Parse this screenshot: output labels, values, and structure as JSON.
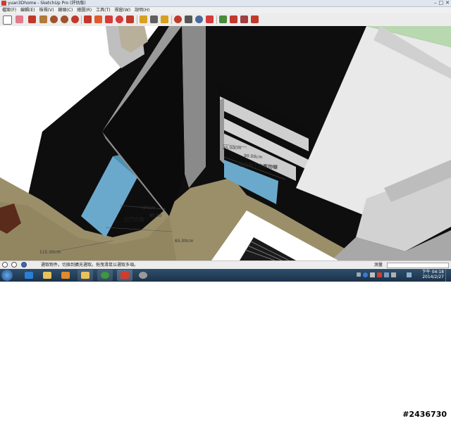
{
  "window": {
    "title": "yuan3Dhome - SketchUp Pro (評估版)",
    "controls": [
      "–",
      "□",
      "✕"
    ]
  },
  "menu": [
    "檔案(F)",
    "編輯(E)",
    "檢視(V)",
    "鏡頭(C)",
    "繪圖(R)",
    "工具(T)",
    "視窗(W)",
    "說明(H)"
  ],
  "toolbar": {
    "tools": [
      {
        "icon": "select-arrow-icon",
        "color": "#3a3a3a"
      },
      {
        "icon": "eraser-icon",
        "color": "#e07a8c"
      },
      {
        "icon": "pencil-line-icon",
        "color": "#c0392b"
      },
      {
        "icon": "rectangle-icon",
        "color": "#b07a3a"
      },
      {
        "icon": "circle-icon",
        "color": "#a0522d"
      },
      {
        "icon": "polygon-icon",
        "color": "#a0522d"
      },
      {
        "icon": "arc-icon",
        "color": "#c0392b"
      },
      {
        "icon": "push-pull-icon",
        "color": "#c0392b"
      },
      {
        "icon": "follow-me-icon",
        "color": "#e05a2a"
      },
      {
        "icon": "move-icon",
        "color": "#d63a3a"
      },
      {
        "icon": "rotate-icon",
        "color": "#d63a3a"
      },
      {
        "icon": "offset-icon",
        "color": "#c0392b"
      },
      {
        "icon": "tape-measure-icon",
        "color": "#d8a020"
      },
      {
        "icon": "dimension-icon",
        "color": "#606060"
      },
      {
        "icon": "text-icon",
        "color": "#d8a020"
      },
      {
        "icon": "orbit-icon",
        "color": "#c0392b"
      },
      {
        "icon": "pan-icon",
        "color": "#555555"
      },
      {
        "icon": "zoom-icon",
        "color": "#4a6a9a"
      },
      {
        "icon": "zoom-extents-icon",
        "color": "#d63a3a"
      },
      {
        "icon": "paint-bucket-icon",
        "color": "#4a8a3a"
      },
      {
        "icon": "components-icon",
        "color": "#c0392b"
      },
      {
        "icon": "warehouse-icon",
        "color": "#a04040"
      },
      {
        "icon": "share-model-icon",
        "color": "#c0392b"
      }
    ]
  },
  "viewport": {
    "dimensions": [
      {
        "name": "dim-90cm",
        "text": "90.00cm"
      },
      {
        "name": "dim-25cm",
        "text": "25.00cm"
      },
      {
        "name": "label-rack",
        "text": "電器櫃下方置物櫃"
      },
      {
        "name": "dim-126cm",
        "text": "126cm"
      },
      {
        "name": "label-closet",
        "text": "拉門衣櫃"
      },
      {
        "name": "dim-95cm",
        "text": "95.00"
      },
      {
        "name": "dim-65cm",
        "text": "65.00cm"
      },
      {
        "name": "dim-115cm",
        "text": "115.00cm"
      }
    ]
  },
  "status": {
    "message": "選取物件。切換到擴充選取。拖曳滑鼠以選取多項。",
    "measure_label": "測量",
    "measure_value": ""
  },
  "taskbar": {
    "apps": [
      {
        "icon": "ie-icon",
        "color": "#2a7fd4"
      },
      {
        "icon": "explorer-folder-icon",
        "color": "#e8c25a"
      },
      {
        "icon": "media-player-icon",
        "color": "#e08a2a"
      },
      {
        "icon": "folder-icon",
        "color": "#e8c25a"
      },
      {
        "icon": "chrome-icon",
        "color": "#3a9a3a"
      },
      {
        "icon": "sketchup-icon",
        "color": "#d23b2e"
      },
      {
        "icon": "control-icon",
        "color": "#9a9a9a"
      }
    ],
    "time": "下午 04:18",
    "date": "2014/2/27"
  },
  "watermark": "#2436730"
}
